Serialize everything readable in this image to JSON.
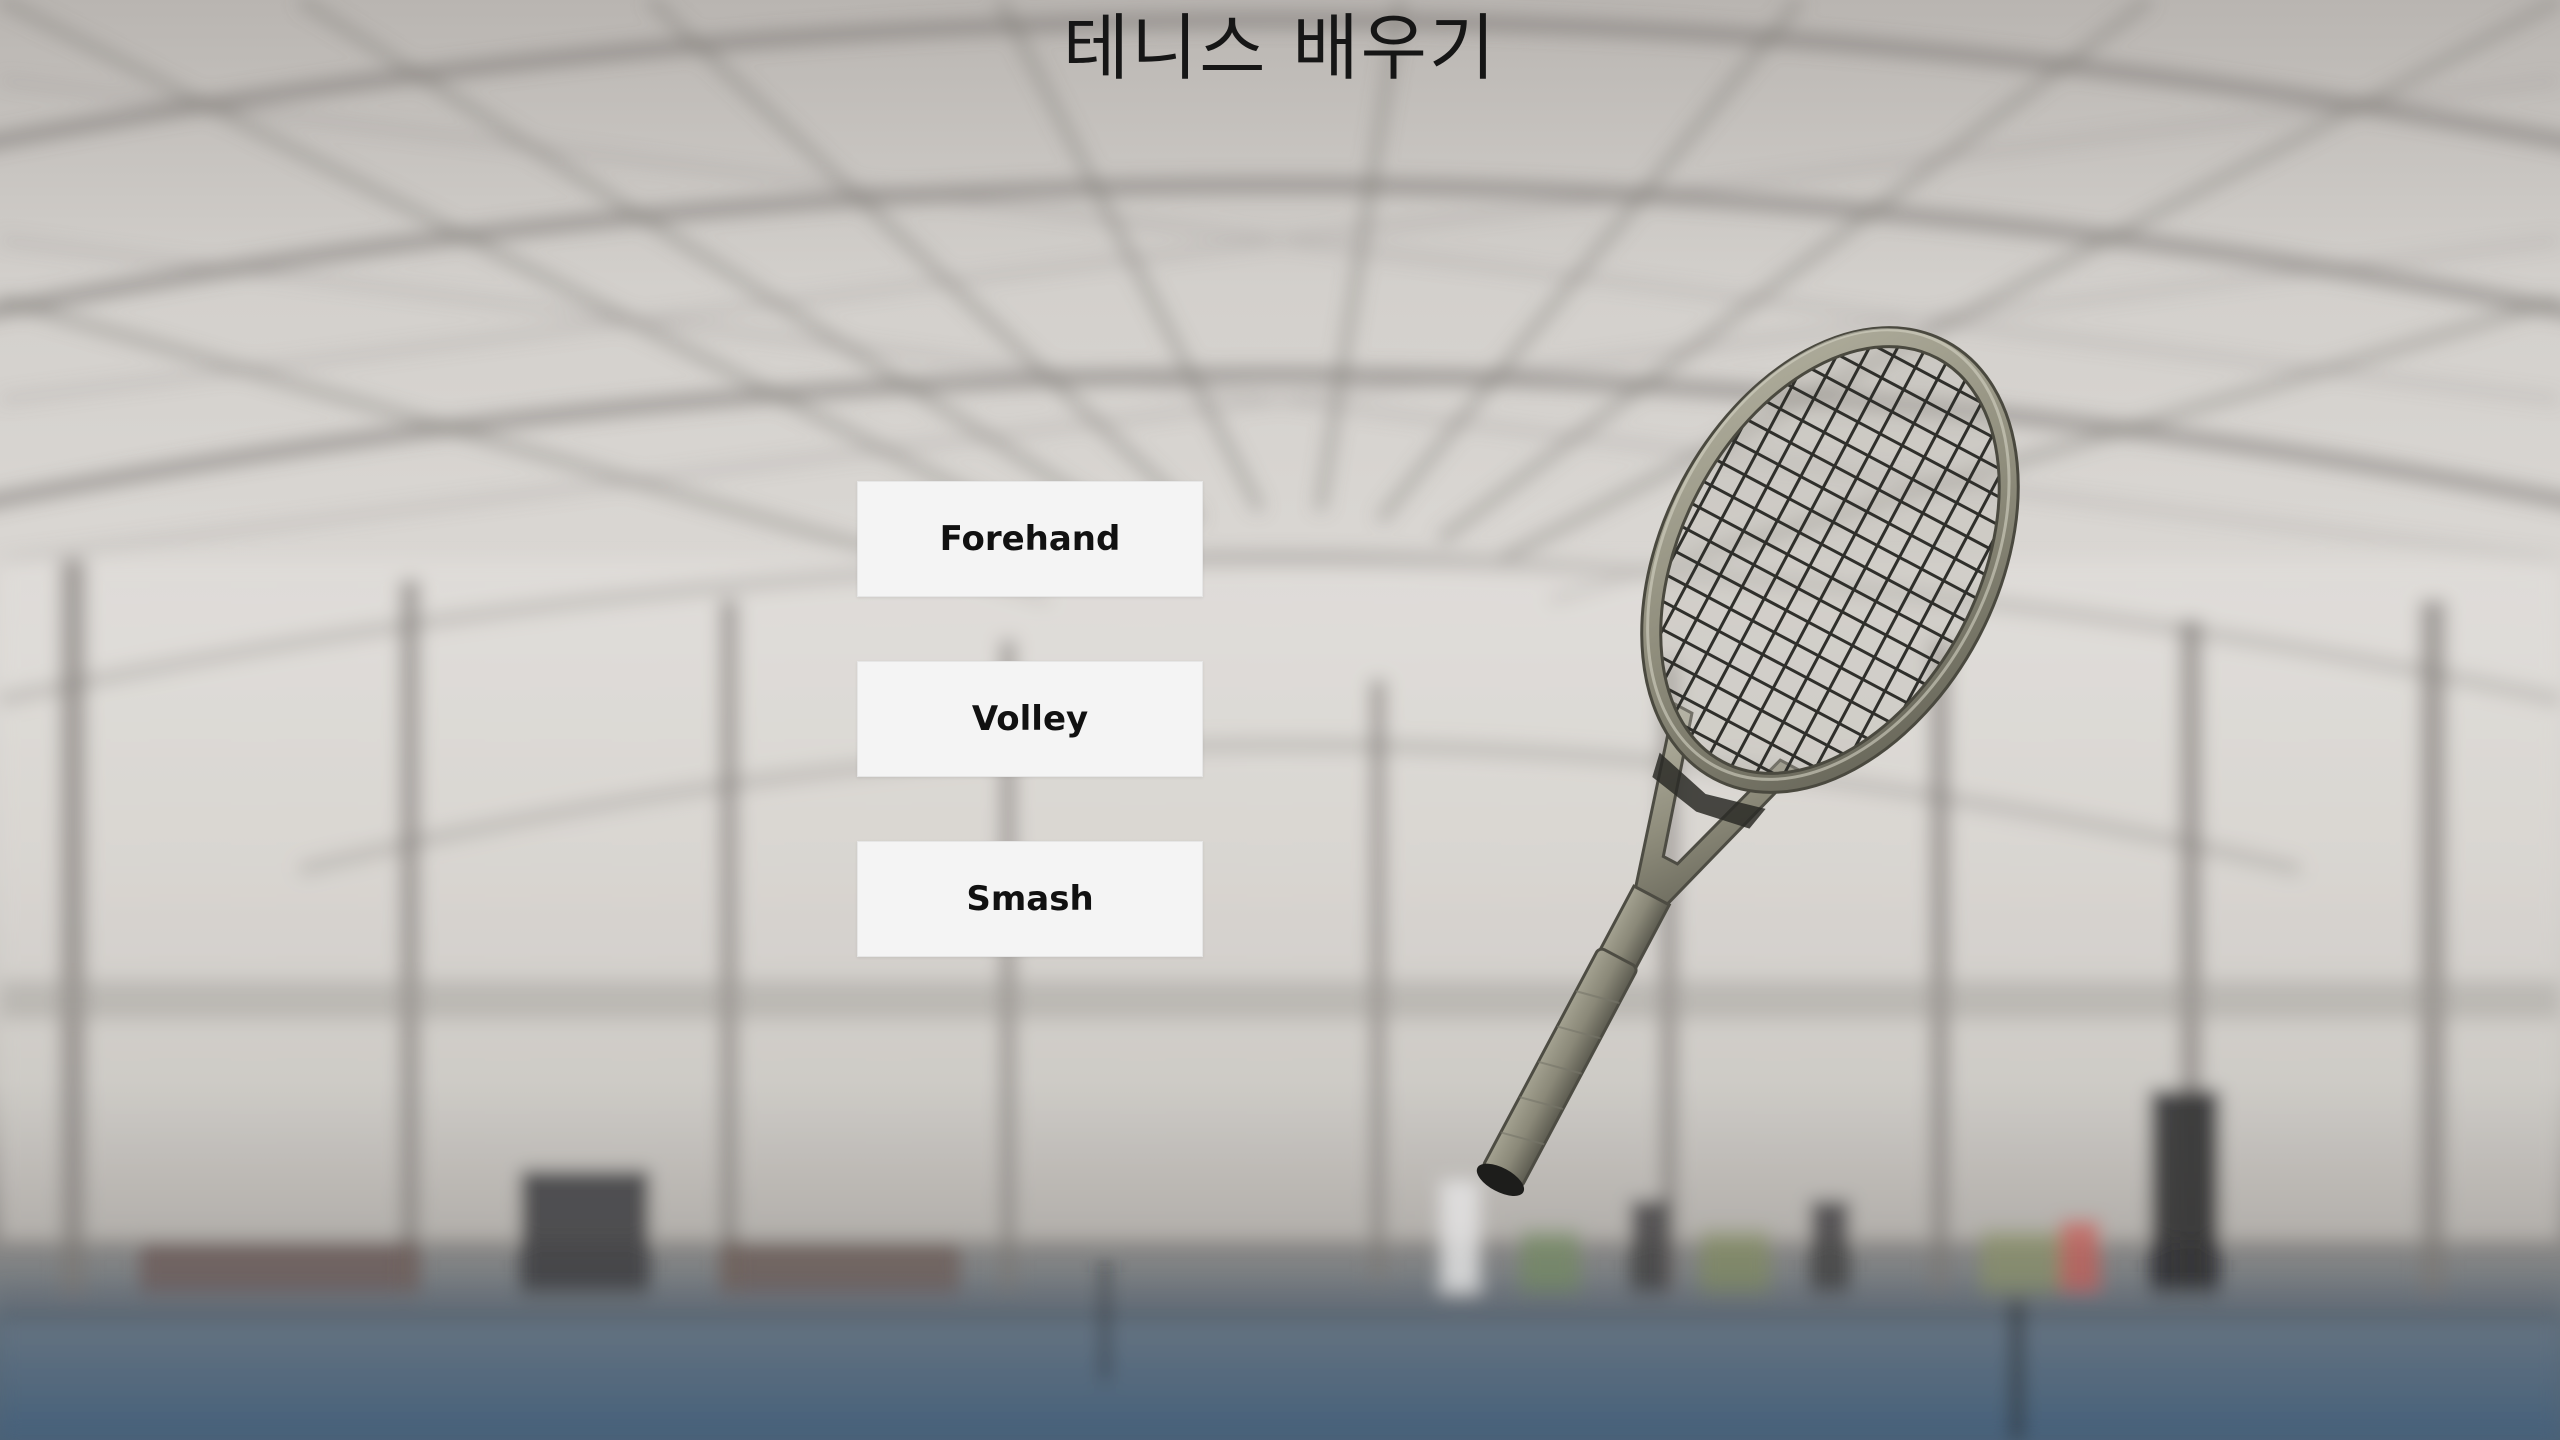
{
  "title": "테니스 배우기",
  "menu": {
    "forehand_label": "Forehand",
    "volley_label": "Volley",
    "smash_label": "Smash"
  },
  "colors": {
    "button_bg": "#f4f4f4",
    "button_text": "#111111",
    "title_text": "#161616",
    "court_blue": "#4c6276",
    "racket_frame": "#8d8b7b"
  },
  "icons": {
    "racket": "tennis-racket-icon"
  }
}
